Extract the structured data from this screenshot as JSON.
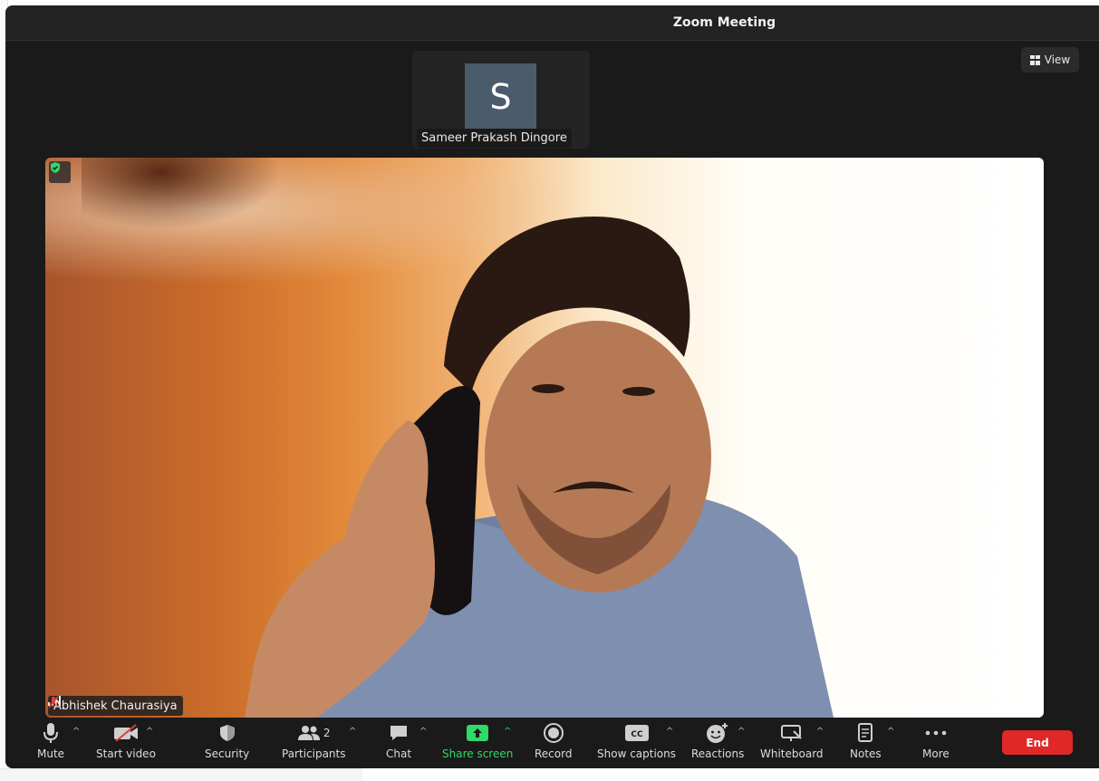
{
  "window": {
    "title": "Zoom Meeting"
  },
  "view_button": {
    "label": "View"
  },
  "thumbnail": {
    "initial": "S",
    "name": "Sameer Prakash Dingore"
  },
  "main_video": {
    "participant_name": "Abhishek Chaurasiya"
  },
  "toolbar": {
    "mute": "Mute",
    "start_video": "Start video",
    "security": "Security",
    "participants": "Participants",
    "participant_count": "2",
    "chat": "Chat",
    "share_screen": "Share screen",
    "record": "Record",
    "show_captions": "Show captions",
    "reactions": "Reactions",
    "whiteboard": "Whiteboard",
    "notes": "Notes",
    "more": "More",
    "end": "End"
  },
  "colors": {
    "end": "#e02828",
    "share": "#2fd96a",
    "titlebar": "#232323"
  }
}
